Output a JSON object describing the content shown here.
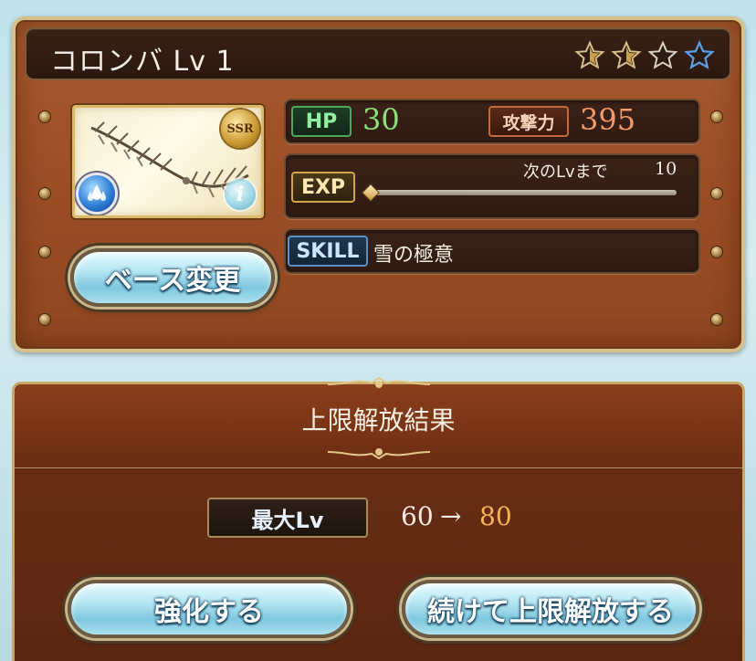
{
  "card": {
    "title": "コロンバ Lv 1",
    "rarity_badge": "SSR",
    "element_icon": "water-element-icon",
    "info_icon": "info-icon",
    "stars_total": 4,
    "stars_filled": 2,
    "stat": {
      "hp_label": "HP",
      "hp_value": "30",
      "atk_label": "攻撃力",
      "atk_value": "395",
      "exp_label": "EXP",
      "next_lv_label": "次のLvまで",
      "next_lv_value": "10",
      "exp_progress": 0,
      "skill_label": "SKILL",
      "skill_name": "雪の極意"
    },
    "change_base_button": "ベース変更"
  },
  "result": {
    "title": "上限解放結果",
    "max_lv_label": "最大Lv",
    "lv_from": "60",
    "arrow": "→",
    "lv_to": "80",
    "enhance_button": "強化する",
    "continue_button": "続けて上限解放する"
  },
  "colors": {
    "hp_value": "#8be07a",
    "atk_value": "#f39a6a",
    "lv_to": "#f3b35a",
    "star_filled": "#c9a24a",
    "star_blue": "#4a8fd8"
  }
}
